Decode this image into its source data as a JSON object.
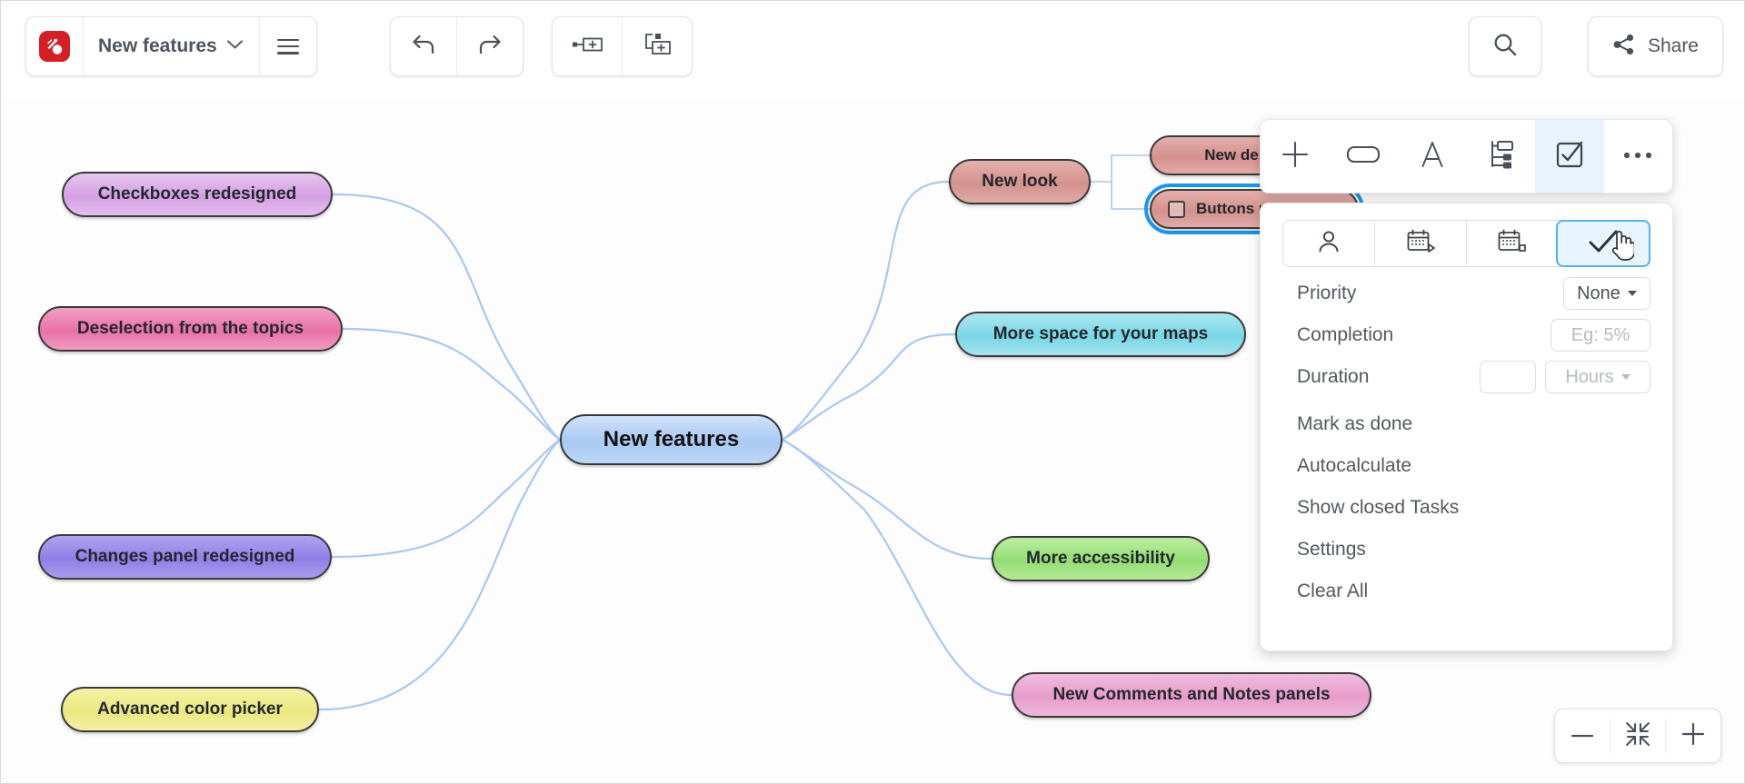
{
  "app": {
    "logo_icon": "mindomo-logo-icon",
    "document_title": "New features",
    "title_dropdown_icon": "chevron-down-icon",
    "menu_icon": "hamburger-menu-icon"
  },
  "toolbar": {
    "undo_icon": "undo-arrow-icon",
    "redo_icon": "redo-arrow-icon",
    "add_sibling_topic_icon": "add-sibling-topic-icon",
    "add_subtopic_icon": "add-subtopic-icon",
    "search_icon": "search-icon",
    "share_icon": "share-icon",
    "share_label": "Share"
  },
  "format_bar": {
    "buttons": [
      {
        "name": "add-topic-button",
        "icon": "plus-icon",
        "active": false
      },
      {
        "name": "shape-button",
        "icon": "rounded-rectangle-icon",
        "active": false
      },
      {
        "name": "text-format-button",
        "icon": "letter-a-icon",
        "active": false
      },
      {
        "name": "layout-button",
        "icon": "tree-layout-icon",
        "active": false
      },
      {
        "name": "task-button",
        "icon": "checkbox-checked-icon",
        "active": true
      },
      {
        "name": "more-options-button",
        "icon": "ellipsis-icon",
        "active": false
      }
    ]
  },
  "task_panel": {
    "segments": [
      {
        "name": "assignee-tab",
        "icon": "person-icon",
        "active": false
      },
      {
        "name": "start-date-tab",
        "icon": "calendar-start-icon",
        "active": false
      },
      {
        "name": "end-date-tab",
        "icon": "calendar-end-icon",
        "active": false
      },
      {
        "name": "progress-tab",
        "icon": "checkmark-icon",
        "active": true
      }
    ],
    "cursor_icon": "pointing-hand-cursor-icon",
    "fields": [
      {
        "label": "Priority",
        "control": "dropdown",
        "value": "None",
        "muted": false,
        "caret_icon": "caret-down-icon"
      },
      {
        "label": "Completion",
        "control": "input",
        "value": "",
        "placeholder": "Eg: 5%",
        "muted": true
      },
      {
        "label": "Duration",
        "control": "input-plus-dropdown",
        "value": "",
        "unit_value": "Hours",
        "muted": true,
        "caret_icon": "caret-down-icon"
      }
    ],
    "menu_items": [
      "Mark as done",
      "Autocalculate",
      "Show closed Tasks",
      "Settings",
      "Clear All"
    ]
  },
  "zoom_controls": {
    "zoom_out_icon": "minus-icon",
    "fit_to_screen_icon": "fit-to-screen-icon",
    "zoom_in_icon": "plus-icon"
  },
  "mindmap": {
    "root": {
      "label": "New features",
      "color": "#a9c9f2"
    },
    "left_branches": [
      {
        "label": "Checkboxes redesigned",
        "color": "#d39fe3"
      },
      {
        "label": "Deselection from the topics",
        "color": "#e871a6"
      },
      {
        "label": "Changes panel redesigned",
        "color": "#8f7ee6"
      },
      {
        "label": "Advanced color picker",
        "color": "#eae87f"
      }
    ],
    "right_branches": [
      {
        "label": "New look",
        "color": "#d4918d"
      },
      {
        "label": "More space for your maps",
        "color": "#78d6e6"
      },
      {
        "label": "More accessibility",
        "color": "#93dd74"
      },
      {
        "label": "New Comments and Notes panels",
        "color": "#e79ccb"
      }
    ],
    "new_look_children": [
      {
        "label": "New design o",
        "color": "#d4918d",
        "selected": false,
        "has_checkbox": false
      },
      {
        "label": "Buttons r",
        "color": "#d4918d",
        "selected": true,
        "has_checkbox": true
      }
    ],
    "selection_color": "#1a96ee",
    "connector_color": "#a8c8f0"
  }
}
